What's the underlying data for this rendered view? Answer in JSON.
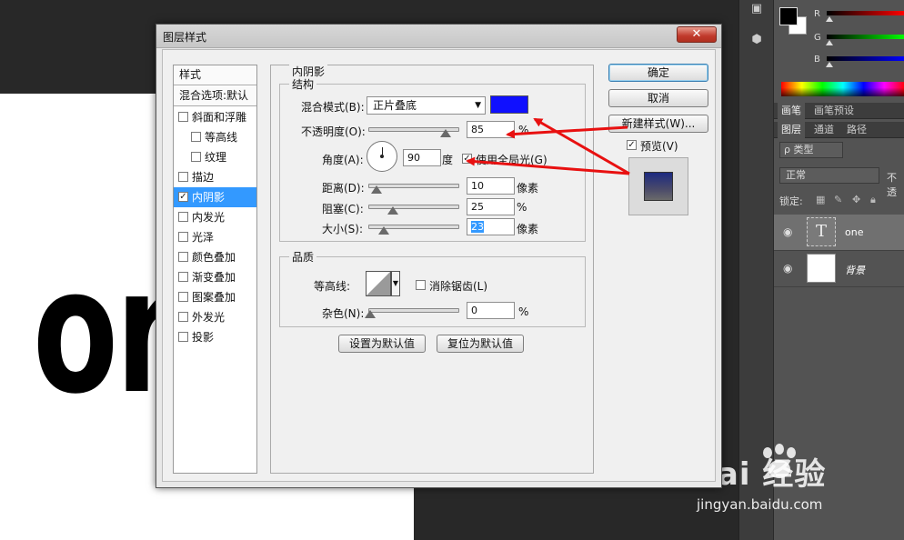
{
  "canvas": {
    "doc_text": "on"
  },
  "panel": {
    "rgb_labels": [
      "R",
      "G",
      "B"
    ],
    "tabs_top": [
      "画笔",
      "画笔预设"
    ],
    "tabs_layers": [
      "图层",
      "通道",
      "路径"
    ],
    "search_kind": "ρ 类型",
    "blend_mode": "正常",
    "opacity_label": "不透",
    "lock_label": "锁定:",
    "layers": [
      {
        "name": "one",
        "type": "text",
        "thumb_glyph": "T",
        "selected": true
      },
      {
        "name": "背景",
        "type": "background",
        "selected": false
      }
    ]
  },
  "watermark": {
    "logo": "Bai 经验",
    "url": "jingyan.baidu.com"
  },
  "dialog": {
    "title": "图层样式",
    "close_label": "✕",
    "style_list": {
      "header": "样式",
      "blend_options": "混合选项:默认",
      "items": [
        {
          "label": "斜面和浮雕",
          "checked": false,
          "indent": false
        },
        {
          "label": "等高线",
          "checked": false,
          "indent": true
        },
        {
          "label": "纹理",
          "checked": false,
          "indent": true
        },
        {
          "label": "描边",
          "checked": false,
          "indent": false
        },
        {
          "label": "内阴影",
          "checked": true,
          "indent": false,
          "selected": true
        },
        {
          "label": "内发光",
          "checked": false,
          "indent": false
        },
        {
          "label": "光泽",
          "checked": false,
          "indent": false
        },
        {
          "label": "颜色叠加",
          "checked": false,
          "indent": false
        },
        {
          "label": "渐变叠加",
          "checked": false,
          "indent": false
        },
        {
          "label": "图案叠加",
          "checked": false,
          "indent": false
        },
        {
          "label": "外发光",
          "checked": false,
          "indent": false
        },
        {
          "label": "投影",
          "checked": false,
          "indent": false
        }
      ]
    },
    "section_title": "内阴影",
    "structure": {
      "title": "结构",
      "blend_mode_label": "混合模式(B):",
      "blend_mode_value": "正片叠底",
      "shadow_color": "#1010ff",
      "opacity_label": "不透明度(O):",
      "opacity_value": "85",
      "opacity_unit": "%",
      "angle_label": "角度(A):",
      "angle_value": "90",
      "angle_unit": "度",
      "global_light_label": "使用全局光(G)",
      "global_light_checked": true,
      "distance_label": "距离(D):",
      "distance_value": "10",
      "distance_unit": "像素",
      "choke_label": "阻塞(C):",
      "choke_value": "25",
      "choke_unit": "%",
      "size_label": "大小(S):",
      "size_value": "23",
      "size_unit": "像素"
    },
    "quality": {
      "title": "品质",
      "contour_label": "等高线:",
      "antialias_label": "消除锯齿(L)",
      "antialias_checked": false,
      "noise_label": "杂色(N):",
      "noise_value": "0",
      "noise_unit": "%"
    },
    "set_default_label": "设置为默认值",
    "reset_default_label": "复位为默认值",
    "ok_label": "确定",
    "cancel_label": "取消",
    "new_style_label": "新建样式(W)...",
    "preview_label": "预览(V)",
    "preview_checked": true
  },
  "colors": {
    "annotation_arrow": "#e81010",
    "selected_item": "#3399ff"
  }
}
